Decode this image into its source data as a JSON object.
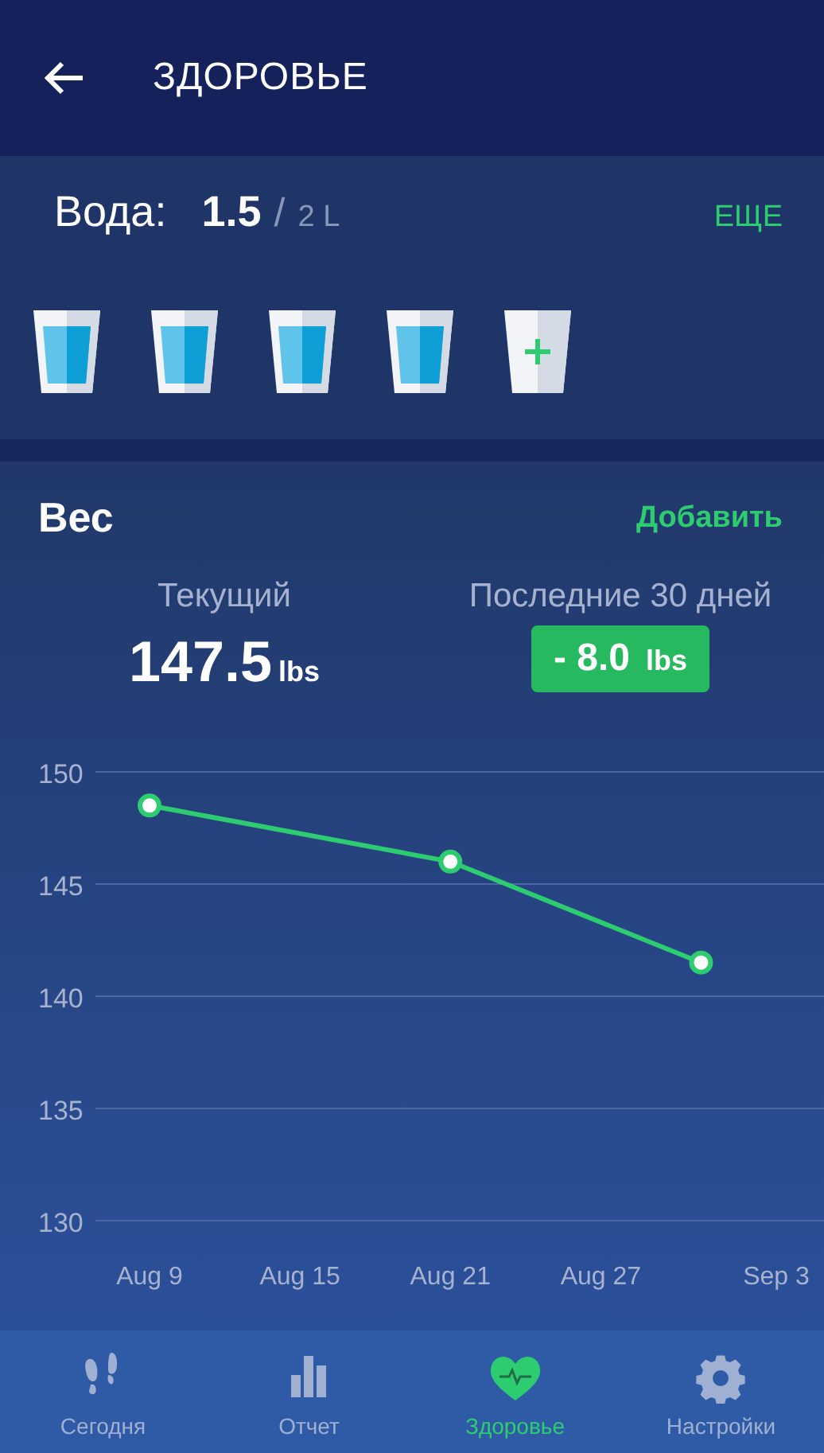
{
  "header": {
    "title": "ЗДОРОВЬЕ"
  },
  "water": {
    "label": "Вода:",
    "amount": "1.5",
    "separator": "/",
    "goal": "2 L",
    "more": "ЕЩЕ",
    "cups": [
      {
        "filled": true
      },
      {
        "filled": true
      },
      {
        "filled": true
      },
      {
        "filled": true
      },
      {
        "filled": false
      }
    ]
  },
  "weight": {
    "title": "Вес",
    "add": "Добавить",
    "current_label": "Текущий",
    "current_value": "147.5",
    "current_unit": "lbs",
    "period_label": "Последние 30 дней",
    "change_value": "- 8.0",
    "change_unit": "lbs",
    "chart_data": {
      "type": "line",
      "categories": [
        "Aug 9",
        null,
        null,
        null,
        null,
        null,
        "Aug 15",
        null,
        null,
        null,
        null,
        null,
        "Aug 21",
        null,
        null,
        null,
        null,
        null,
        "Aug 27",
        null,
        null,
        null,
        null,
        null,
        null,
        "Sep 3"
      ],
      "series": [
        {
          "color": "#2ecc71",
          "marker": "circle",
          "values": [
            148.5,
            null,
            null,
            null,
            null,
            null,
            null,
            null,
            null,
            null,
            null,
            null,
            146,
            null,
            null,
            null,
            null,
            null,
            null,
            null,
            null,
            null,
            141.5,
            null,
            null,
            null
          ]
        }
      ],
      "ylim": [
        130,
        150
      ],
      "grid": true,
      "yticks": [
        150,
        145,
        140,
        135,
        130
      ]
    }
  },
  "nav": [
    {
      "label": "Сегодня",
      "selected": false
    },
    {
      "label": "Отчет",
      "selected": false
    },
    {
      "label": "Здоровье",
      "selected": true
    },
    {
      "label": "Настройки",
      "selected": false
    }
  ]
}
